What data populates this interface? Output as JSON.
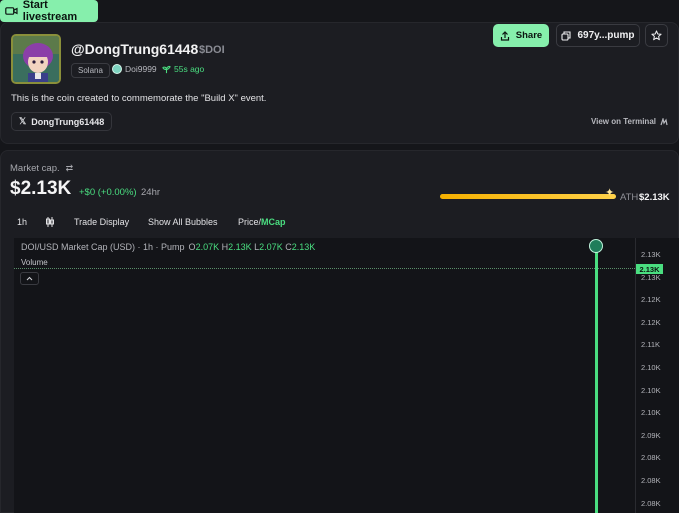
{
  "stream": {
    "label": "Start livestream",
    "color": "#86efac"
  },
  "coin": {
    "handle": "@DongTrung61448",
    "ticker": "$DOI",
    "chain": "Solana",
    "creator": "Doi9999",
    "age": "55s ago",
    "description": "This is the coin created to commemorate the \"Build X\" event.",
    "x_handle": "DongTrung61448",
    "terminal_link": "View on Terminal"
  },
  "actions": {
    "share_label": "Share",
    "contract_address": "697y...pump"
  },
  "market": {
    "label": "Market cap.",
    "value": "$2.13K",
    "change": "+$0 (+0.00%)",
    "period": "24hr",
    "ath_label": "ATH",
    "ath_value": "$2.13K",
    "ath_progress": 1.0
  },
  "toolbar": {
    "interval": "1h",
    "trade_display": "Trade Display",
    "bubbles": "Show All Bubbles",
    "price": "Price",
    "sep": "/",
    "mcap": "MCap"
  },
  "chart": {
    "legend": "DOI/USD Market Cap (USD) · 1h · Pump",
    "o_key": "O",
    "o": "2.07K",
    "h_key": "H",
    "h": "2.13K",
    "l_key": "L",
    "l": "2.07K",
    "c_key": "C",
    "c": "2.13K",
    "volume_label": "Volume",
    "current_price": "2.13K"
  },
  "chart_data": {
    "type": "line",
    "title": "DOI/USD Market Cap (USD) · 1h · Pump",
    "ylabel": "",
    "xlabel": "",
    "y_tick_labels": [
      "2.13K",
      "2.13K",
      "2.12K",
      "2.12K",
      "2.11K",
      "2.10K",
      "2.10K",
      "2.10K",
      "2.09K",
      "2.08K",
      "2.08K",
      "2.08K"
    ],
    "series": [
      {
        "name": "DOI/USD",
        "open": 2070,
        "high": 2130,
        "low": 2070,
        "close": 2130
      }
    ],
    "grid": false
  }
}
